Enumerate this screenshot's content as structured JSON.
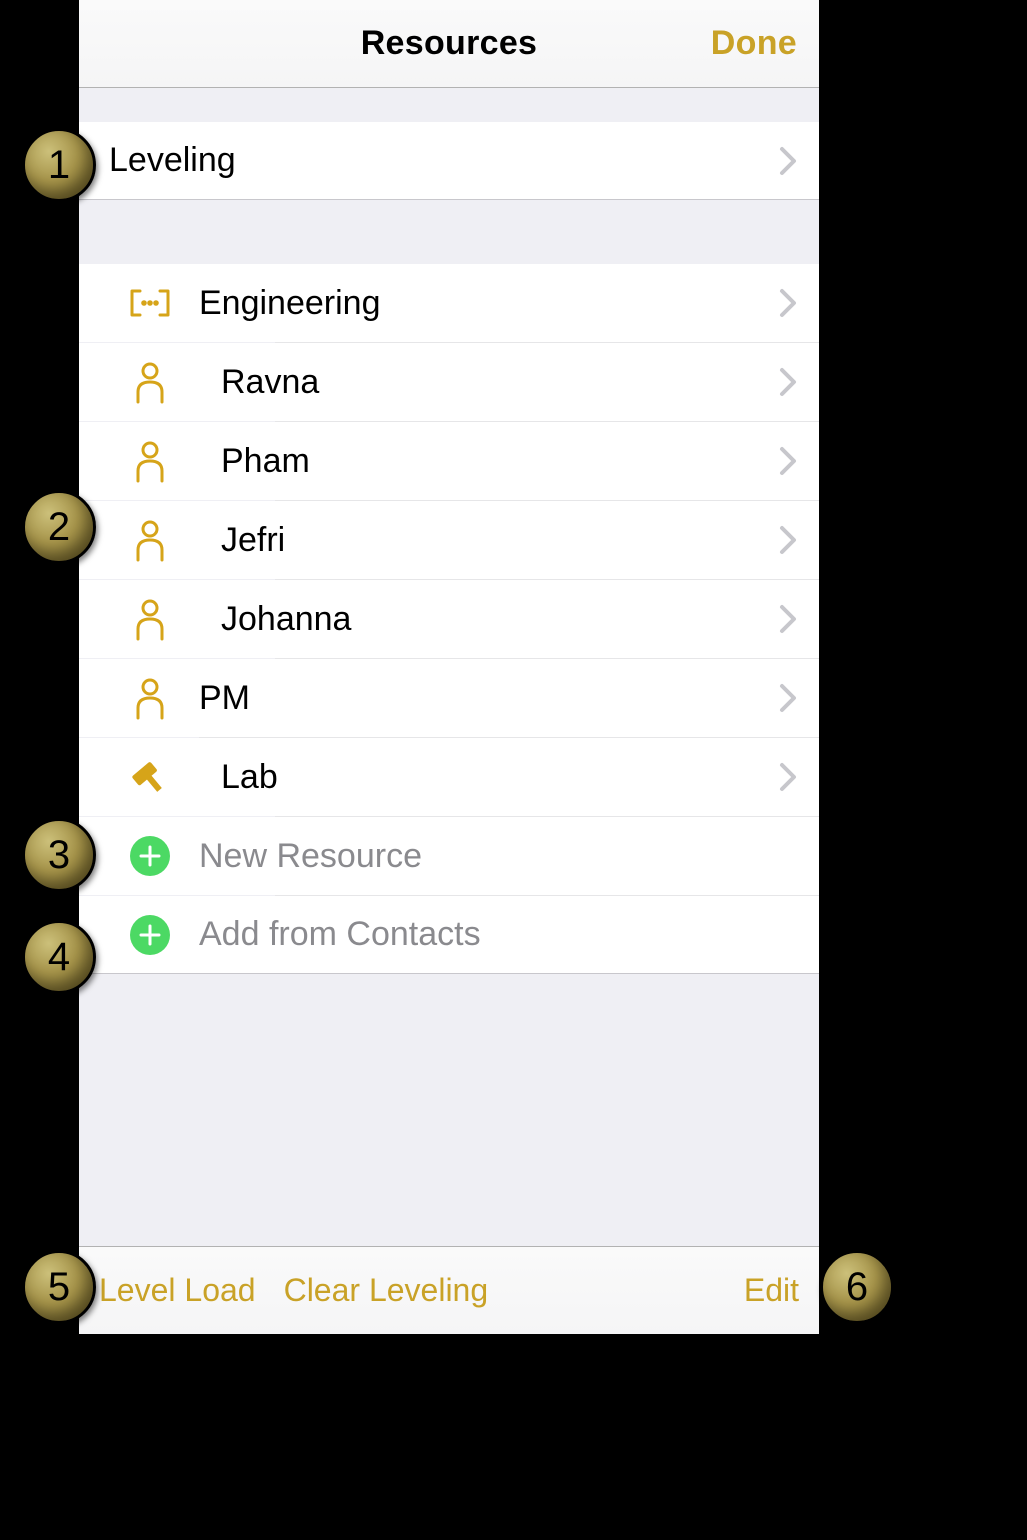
{
  "navbar": {
    "title": "Resources",
    "done": "Done"
  },
  "leveling": {
    "label": "Leveling"
  },
  "groups": [
    {
      "type": "group",
      "name": "Engineering",
      "icon": "group-icon"
    },
    {
      "type": "person",
      "name": "Ravna",
      "icon": "person-icon",
      "indent": true
    },
    {
      "type": "person",
      "name": "Pham",
      "icon": "person-icon",
      "indent": true
    },
    {
      "type": "person",
      "name": "Jefri",
      "icon": "person-icon",
      "indent": true
    },
    {
      "type": "person",
      "name": "Johanna",
      "icon": "person-icon",
      "indent": true
    },
    {
      "type": "person",
      "name": "PM",
      "icon": "person-icon",
      "indent": false
    },
    {
      "type": "equipment",
      "name": "Lab",
      "icon": "hammer-icon",
      "indent": true
    }
  ],
  "actions": {
    "new_resource": "New Resource",
    "add_contacts": "Add from Contacts"
  },
  "toolbar": {
    "level_load": "Level Load",
    "clear_leveling": "Clear Leveling",
    "edit": "Edit"
  },
  "callouts": [
    "1",
    "2",
    "3",
    "4",
    "5",
    "6"
  ],
  "colors": {
    "accent": "#c9a227",
    "icon_gold": "#d6a419",
    "action_green": "#4cd964"
  }
}
